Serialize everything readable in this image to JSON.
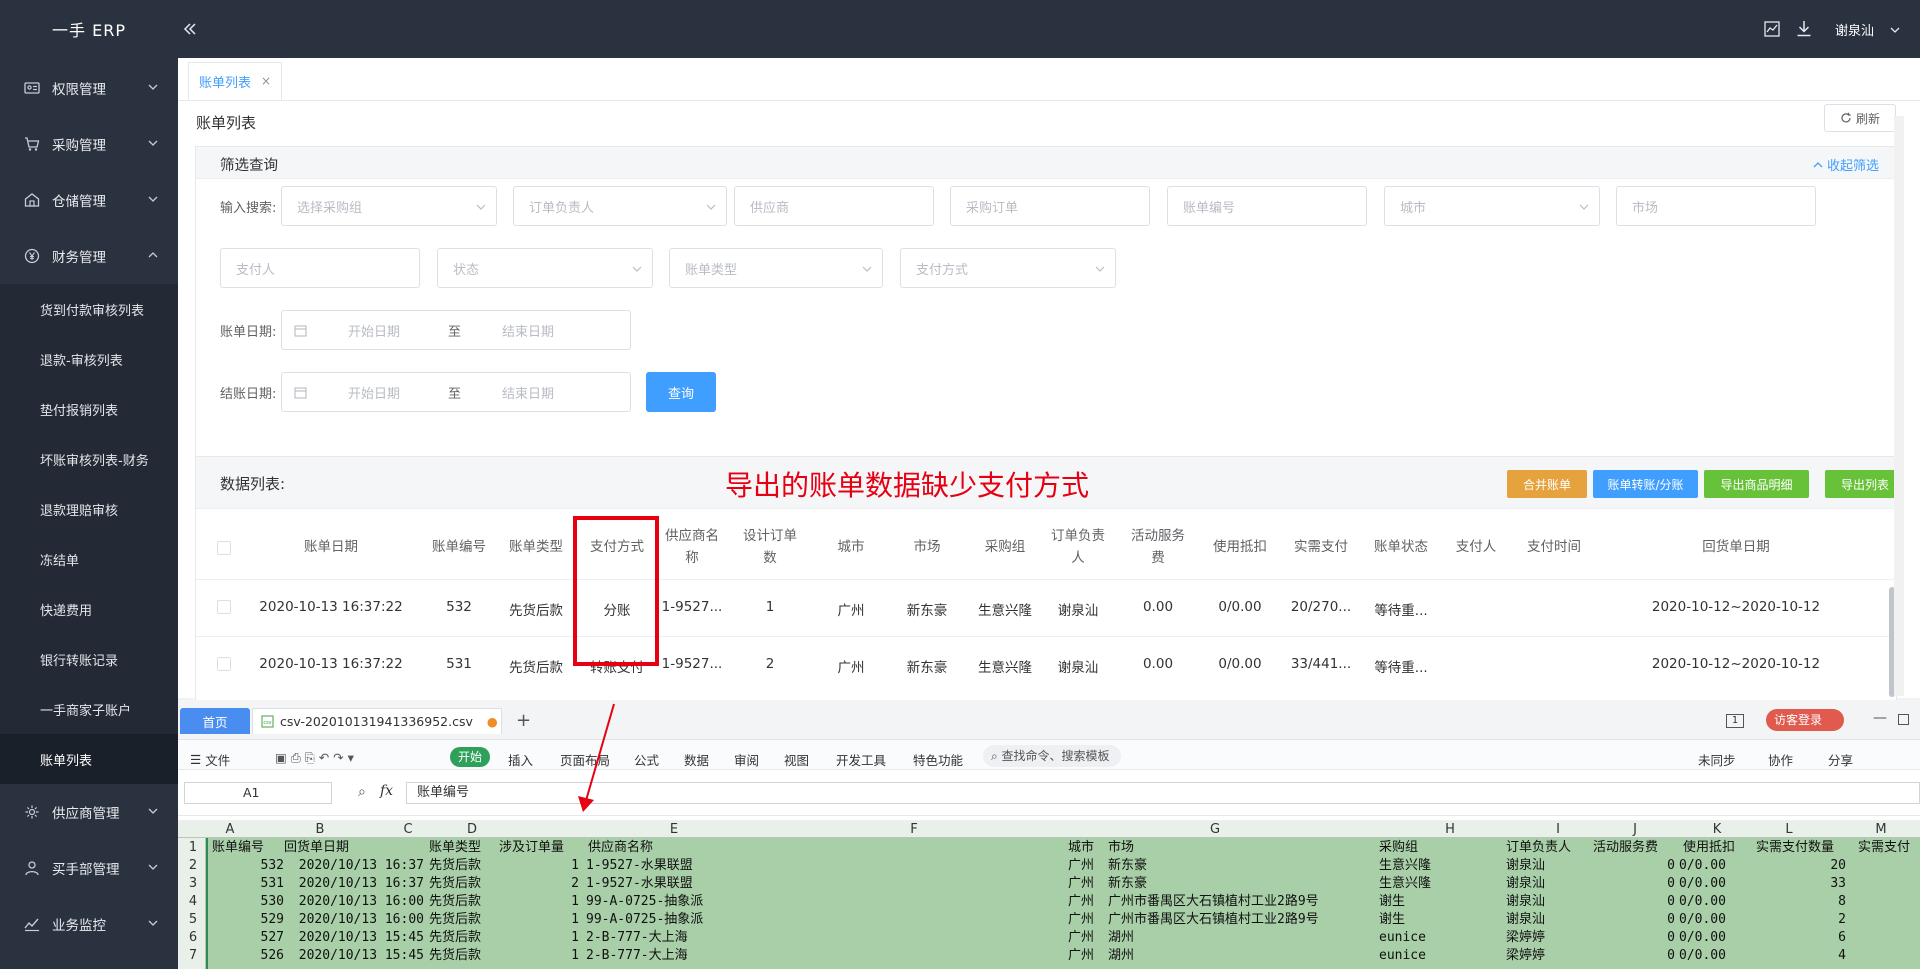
{
  "app": {
    "logo": "一手 ERP"
  },
  "topbar": {
    "user": "谢泉汕"
  },
  "sidebar": {
    "menu": [
      {
        "label": "权限管理",
        "icon": "id-card-icon"
      },
      {
        "label": "采购管理",
        "icon": "cart-icon"
      },
      {
        "label": "仓储管理",
        "icon": "warehouse-icon"
      },
      {
        "label": "财务管理",
        "icon": "yen-icon"
      }
    ],
    "finance_items": [
      "货到付款审核列表",
      "退款-审核列表",
      "垫付报销列表",
      "坏账审核列表-财务",
      "退款理赔审核",
      "冻结单",
      "快递费用",
      "银行转账记录",
      "一手商家子账户",
      "账单列表"
    ],
    "menu_bottom": [
      {
        "label": "供应商管理",
        "icon": "supplier-icon"
      },
      {
        "label": "买手部管理",
        "icon": "buyer-icon"
      },
      {
        "label": "业务监控",
        "icon": "monitor-icon"
      }
    ]
  },
  "tabs": {
    "active": "账单列表",
    "close": "×"
  },
  "page": {
    "title": "账单列表",
    "refresh": "刷新"
  },
  "filter": {
    "title": "筛选查询",
    "collapse": "收起筛选",
    "search_label": "输入搜索:",
    "row1": [
      "选择采购组",
      "订单负责人",
      "供应商",
      "采购订单",
      "账单编号",
      "城市",
      "市场"
    ],
    "row2": [
      "支付人",
      "状态",
      "账单类型",
      "支付方式"
    ],
    "bill_date_label": "账单日期:",
    "settle_date_label": "结账日期:",
    "start": "开始日期",
    "to": "至",
    "end": "结束日期",
    "query": "查询"
  },
  "list": {
    "title": "数据列表:",
    "annotation": "导出的账单数据缺少支付方式",
    "buttons": [
      "合并账单",
      "账单转账/分账",
      "导出商品明细",
      "导出列表"
    ],
    "headers": [
      "账单日期",
      "账单编号",
      "账单类型",
      "支付方式",
      "供应商名称",
      "设计订单数",
      "城市",
      "市场",
      "采购组",
      "订单负责人",
      "活动服务费",
      "使用抵扣",
      "实需支付",
      "账单状态",
      "支付人",
      "支付时间",
      "回货单日期"
    ],
    "rows": [
      [
        "2020-10-13 16:37:22",
        "532",
        "先货后款",
        "分账",
        "1-9527...",
        "1",
        "广州",
        "新东豪",
        "生意兴隆",
        "谢泉汕",
        "0.00",
        "0/0.00",
        "20/270...",
        "等待重...",
        "",
        "",
        "2020-10-12~2020-10-12"
      ],
      [
        "2020-10-13 16:37:22",
        "531",
        "先货后款",
        "转账支付",
        "1-9527...",
        "2",
        "广州",
        "新东豪",
        "生意兴隆",
        "谢泉汕",
        "0.00",
        "0/0.00",
        "33/441...",
        "等待重...",
        "",
        "",
        "2020-10-12~2020-10-12"
      ]
    ]
  },
  "wps": {
    "home_tab": "首页",
    "file_tab": "csv-202010131941336952.csv",
    "add": "+",
    "badge": "1",
    "visitor": "访客登录",
    "menus": [
      "文件",
      "开始",
      "插入",
      "页面布局",
      "公式",
      "数据",
      "审阅",
      "视图",
      "开发工具",
      "特色功能"
    ],
    "search": "查找命令、搜索模板",
    "right": [
      "未同步",
      "协作",
      "分享"
    ],
    "cell_ref": "A1",
    "fx": "fx",
    "formula": "账单编号",
    "columns": [
      "A",
      "B",
      "C",
      "D",
      "E",
      "F",
      "G",
      "H",
      "I",
      "J",
      "K",
      "L",
      "M"
    ],
    "row_numbers": [
      "1",
      "2",
      "3",
      "4",
      "5",
      "6",
      "7"
    ],
    "header_row": [
      "账单编号",
      "回货单日期",
      "账单类型",
      "涉及订单量",
      "供应商名称",
      "城市",
      "市场",
      "采购组",
      "订单负责人",
      "活动服务费",
      "使用抵扣",
      "实需支付数量",
      "实需支付"
    ],
    "rows": [
      [
        "532",
        "2020/10/13 16:37",
        "先货后款",
        "1",
        "1-9527-水果联盟",
        "广州",
        "新东豪",
        "生意兴隆",
        "谢泉汕",
        "0",
        "0/0.00",
        "20"
      ],
      [
        "531",
        "2020/10/13 16:37",
        "先货后款",
        "2",
        "1-9527-水果联盟",
        "广州",
        "新东豪",
        "生意兴隆",
        "谢泉汕",
        "0",
        "0/0.00",
        "33"
      ],
      [
        "530",
        "2020/10/13 16:00",
        "先货后款",
        "1",
        "99-A-0725-抽象派",
        "广州",
        "广州市番禺区大石镇植村工业2路9号",
        "谢生",
        "谢泉汕",
        "0",
        "0/0.00",
        "8"
      ],
      [
        "529",
        "2020/10/13 16:00",
        "先货后款",
        "1",
        "99-A-0725-抽象派",
        "广州",
        "广州市番禺区大石镇植村工业2路9号",
        "谢生",
        "谢泉汕",
        "0",
        "0/0.00",
        "2"
      ],
      [
        "527",
        "2020/10/13 15:45",
        "先货后款",
        "1",
        "2-B-777-大上海",
        "广州",
        "湖州",
        "eunice",
        "梁婷婷",
        "0",
        "0/0.00",
        "6"
      ],
      [
        "526",
        "2020/10/13 15:45",
        "先货后款",
        "1",
        "2-B-777-大上海",
        "广州",
        "湖州",
        "eunice",
        "梁婷婷",
        "0",
        "0/0.00",
        "4"
      ]
    ]
  },
  "colors": {
    "sidebar": "#2b323f",
    "primary": "#409eff",
    "orange": "#e6a23c",
    "blue": "#409eff",
    "green": "#67c23a",
    "annotation": "#e60012",
    "sheet_green": "#9bc89b"
  }
}
